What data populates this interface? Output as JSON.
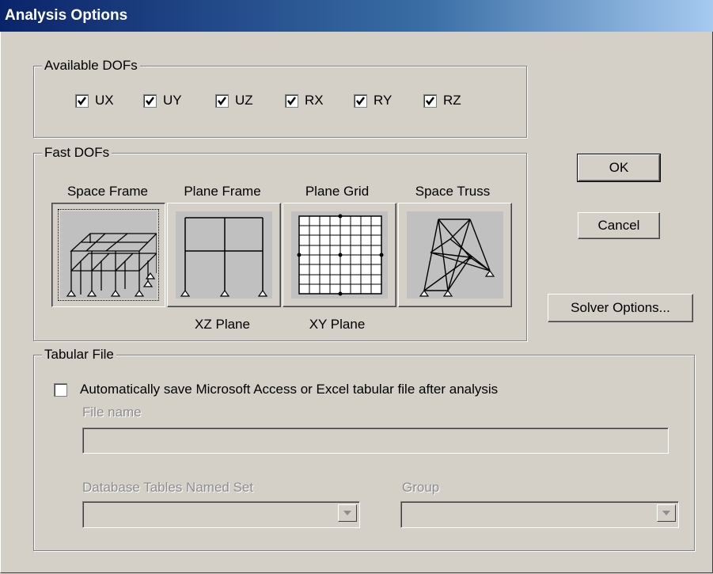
{
  "window": {
    "title": "Analysis Options"
  },
  "available_dofs": {
    "title": "Available DOFs",
    "items": [
      {
        "label": "UX",
        "checked": true
      },
      {
        "label": "UY",
        "checked": true
      },
      {
        "label": "UZ",
        "checked": true
      },
      {
        "label": "RX",
        "checked": true
      },
      {
        "label": "RY",
        "checked": true
      },
      {
        "label": "RZ",
        "checked": true
      }
    ]
  },
  "fast_dofs": {
    "title": "Fast DOFs",
    "options": [
      {
        "label": "Space Frame",
        "sublabel": "",
        "selected": true
      },
      {
        "label": "Plane Frame",
        "sublabel": "XZ Plane",
        "selected": false
      },
      {
        "label": "Plane Grid",
        "sublabel": "XY Plane",
        "selected": false
      },
      {
        "label": "Space Truss",
        "sublabel": "",
        "selected": false
      }
    ]
  },
  "buttons": {
    "ok": "OK",
    "cancel": "Cancel",
    "solver_options": "Solver Options..."
  },
  "tabular_file": {
    "title": "Tabular File",
    "auto_save_label": "Automatically save Microsoft Access or Excel tabular file after analysis",
    "auto_save_checked": false,
    "file_name_label": "File name",
    "file_name_value": "",
    "db_tables_label": "Database Tables Named Set",
    "db_tables_value": "",
    "group_label": "Group",
    "group_value": ""
  }
}
